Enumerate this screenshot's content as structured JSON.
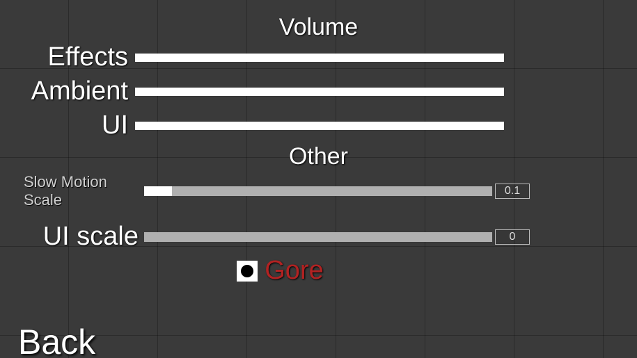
{
  "sections": {
    "volume": {
      "title": "Volume",
      "effects": {
        "label": "Effects",
        "value": 1.0
      },
      "ambient": {
        "label": "Ambient",
        "value": 1.0
      },
      "ui": {
        "label": "UI",
        "value": 1.0
      }
    },
    "other": {
      "title": "Other",
      "slow_motion": {
        "label": "Slow Motion Scale",
        "value": 0.1,
        "display": "0.1",
        "fill": 0.08
      },
      "ui_scale": {
        "label": "UI scale",
        "value": 0,
        "display": "0",
        "fill": 0.0
      },
      "gore": {
        "label": "Gore",
        "checked": true
      }
    }
  },
  "back_label": "Back"
}
